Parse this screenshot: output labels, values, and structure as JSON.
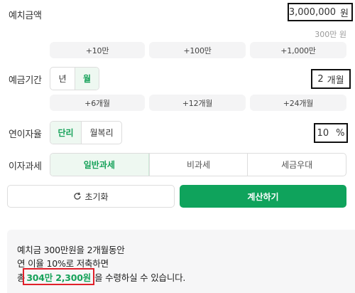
{
  "deposit": {
    "label": "예치금액",
    "value": "3,000,000",
    "unit": "원",
    "hint": "300만 원",
    "quick_buttons": [
      "+10만",
      "+100만",
      "+1,000만"
    ]
  },
  "period": {
    "label": "예금기간",
    "options": [
      "년",
      "월"
    ],
    "selected": "월",
    "value": "2",
    "unit": "개월",
    "quick_buttons": [
      "+6개월",
      "+12개월",
      "+24개월"
    ]
  },
  "rate": {
    "label": "연이자율",
    "options": [
      "단리",
      "월복리"
    ],
    "selected": "단리",
    "value": "10",
    "unit": "%"
  },
  "tax": {
    "label": "이자과세",
    "options": [
      "일반과세",
      "비과세",
      "세금우대"
    ],
    "selected": "일반과세"
  },
  "actions": {
    "reset_label": "초기화",
    "calculate_label": "계산하기"
  },
  "result": {
    "line1": "예치금 300만원을 2개월동안",
    "line2": "연 이율 10%로 저축하면",
    "line3_prefix": "총",
    "total": "304만 2,300원",
    "line3_suffix": "을 수령하실 수 있습니다."
  },
  "colors": {
    "accent": "#0fa35c",
    "accent_text": "#17a25a",
    "highlight_box": "#e0202a"
  }
}
